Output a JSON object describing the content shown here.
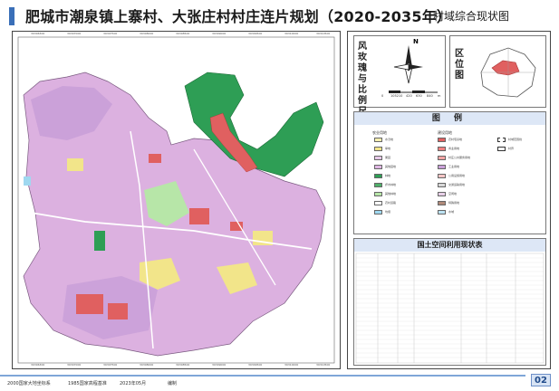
{
  "header": {
    "title": "肥城市潮泉镇上寨村、大张庄村村庄连片规划（2020-2035年）",
    "subtitle": "村域综合现状图"
  },
  "map": {
    "top_coords": [
      "39306300",
      "39307000",
      "39307500",
      "39308000",
      "39308500",
      "39309000",
      "39309500",
      "39310000",
      "39310500"
    ],
    "bottom_coords": [
      "39306300",
      "39307000",
      "39307500",
      "39308000",
      "39308500",
      "39309000",
      "39309500",
      "39310000",
      "39310500"
    ],
    "colors": {
      "village_land": "#dcb1e0",
      "construction": "#e06060",
      "forest": "#2e9e55",
      "farmland": "#f2e58a",
      "grass": "#b7e6a8",
      "industrial": "#c9a0d8",
      "water": "#9fd8f0",
      "road": "#ffffff"
    }
  },
  "panel": {
    "north_arrow_label": "风玫瑰与比例尺",
    "north_letter": "N",
    "scale_ticks": [
      "0",
      "105210",
      "420",
      "630",
      "840"
    ],
    "scale_unit": "m",
    "location_label": "区位图",
    "legend_title": "图 例",
    "legend_col1_title": "农业用地",
    "legend_col2_title": "建设用地",
    "legend_col1": [
      {
        "label": "水浇地",
        "color": "#f5efb0"
      },
      {
        "label": "旱地",
        "color": "#f2e58a"
      },
      {
        "label": "果园",
        "color": "#e7c9e9"
      },
      {
        "label": "其他园地",
        "color": "#e0b7e4"
      },
      {
        "label": "林地",
        "color": "#2e9e55"
      },
      {
        "label": "乔木林地",
        "color": "#4fb06a"
      },
      {
        "label": "其他林地",
        "color": "#b7e6a8"
      },
      {
        "label": "农村道路",
        "color": "#ffffff"
      },
      {
        "label": "坑塘",
        "color": "#9fd8f0"
      }
    ],
    "legend_col2": [
      {
        "label": "农村宅基地",
        "color": "#e06060"
      },
      {
        "label": "商业用地",
        "color": "#f08080"
      },
      {
        "label": "村庄公共服务用地",
        "color": "#f4a6a6"
      },
      {
        "label": "工业用地",
        "color": "#c9a0d8"
      },
      {
        "label": "公用设施用地",
        "color": "#f7c6c6"
      },
      {
        "label": "交通运输用地",
        "color": "#d8d8d8"
      },
      {
        "label": "空闲地",
        "color": "#e8d0e8"
      },
      {
        "label": "特殊用地",
        "color": "#b08a7a"
      },
      {
        "label": "水域",
        "color": "#bde3f3"
      }
    ],
    "legend_col3": [
      {
        "label": "村域范围线",
        "color": "#ffffff"
      },
      {
        "label": "村界",
        "color": "#ffffff"
      }
    ],
    "table_title": "国土空间利用现状表"
  },
  "footer": {
    "texts": [
      "2000国家大地坐标系",
      "1985国家高程基准",
      "2023年05月",
      "编制"
    ],
    "page_number": "02"
  }
}
